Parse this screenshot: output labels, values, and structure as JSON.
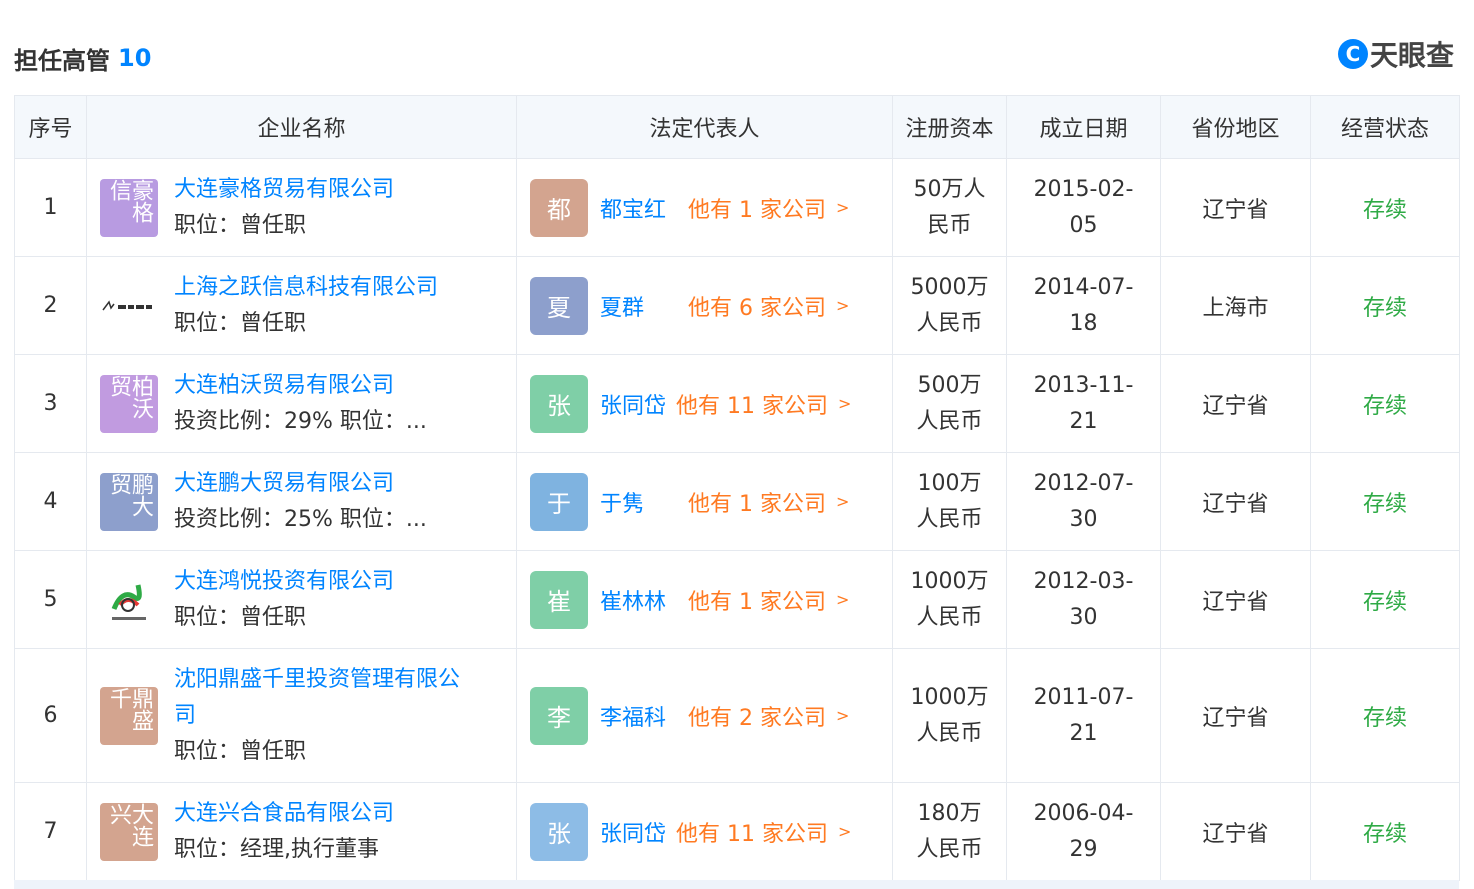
{
  "header": {
    "title": "担任高管",
    "count": "10",
    "brand": "天眼查",
    "brand_mark": "C"
  },
  "table": {
    "columns": [
      "序号",
      "企业名称",
      "法定代表人",
      "注册资本",
      "成立日期",
      "省份地区",
      "经营状态"
    ],
    "rows": [
      {
        "no": "1",
        "logo_text": "豪格信",
        "logo_color": "#b89be1",
        "name": "大连豪格贸易有限公司",
        "sub": "职位：曾任职",
        "rep_initial": "都",
        "rep_color": "#d3a48f",
        "rep_name": "都宝红",
        "rep_link": "他有 1 家公司",
        "capital_1": "50万人",
        "capital_2": "民币",
        "date_1": "2015-02-",
        "date_2": "05",
        "region": "辽宁省",
        "status": "存续"
      },
      {
        "no": "2",
        "logo_text": "",
        "logo_color": "",
        "name": "上海之跃信息科技有限公司",
        "sub": "职位：曾任职",
        "rep_initial": "夏",
        "rep_color": "#8d9fcc",
        "rep_name": "夏群",
        "rep_link": "他有 6 家公司",
        "capital_1": "5000万",
        "capital_2": "人民币",
        "date_1": "2014-07-",
        "date_2": "18",
        "region": "上海市",
        "status": "存续"
      },
      {
        "no": "3",
        "logo_text": "柏沃贸",
        "logo_color": "#c19be0",
        "name": "大连柏沃贸易有限公司",
        "sub": "投资比例：29%   职位：...",
        "rep_initial": "张",
        "rep_color": "#7fcfa7",
        "rep_name": "张同岱",
        "rep_link": "他有 11 家公司",
        "capital_1": "500万",
        "capital_2": "人民币",
        "date_1": "2013-11-",
        "date_2": "21",
        "region": "辽宁省",
        "status": "存续"
      },
      {
        "no": "4",
        "logo_text": "鹏大贸",
        "logo_color": "#8d9fcc",
        "name": "大连鹏大贸易有限公司",
        "sub": "投资比例：25%   职位：...",
        "rep_initial": "于",
        "rep_color": "#7fb3e0",
        "rep_name": "于隽",
        "rep_link": "他有 1 家公司",
        "capital_1": "100万",
        "capital_2": "人民币",
        "date_1": "2012-07-",
        "date_2": "30",
        "region": "辽宁省",
        "status": "存续"
      },
      {
        "no": "5",
        "logo_text": "",
        "logo_color": "",
        "name": "大连鸿悦投资有限公司",
        "sub": "职位：曾任职",
        "rep_initial": "崔",
        "rep_color": "#7fcfa7",
        "rep_name": "崔林林",
        "rep_link": "他有 1 家公司",
        "capital_1": "1000万",
        "capital_2": "人民币",
        "date_1": "2012-03-",
        "date_2": "30",
        "region": "辽宁省",
        "status": "存续"
      },
      {
        "no": "6",
        "logo_text": "鼎盛千",
        "logo_color": "#d3a48f",
        "name_1": "沈阳鼎盛千里投资管理有限公",
        "name_2": "司",
        "sub": "职位：曾任职",
        "rep_initial": "李",
        "rep_color": "#7fcfa7",
        "rep_name": "李福科",
        "rep_link": "他有 2 家公司",
        "capital_1": "1000万",
        "capital_2": "人民币",
        "date_1": "2011-07-",
        "date_2": "21",
        "region": "辽宁省",
        "status": "存续"
      },
      {
        "no": "7",
        "logo_text": "大连兴",
        "logo_color": "#d3a48f",
        "name": "大连兴合食品有限公司",
        "sub": "职位：经理,执行董事",
        "rep_initial": "张",
        "rep_color": "#8dbce6",
        "rep_name": "张同岱",
        "rep_link": "他有 11 家公司",
        "capital_1": "180万",
        "capital_2": "人民币",
        "date_1": "2006-04-",
        "date_2": "29",
        "region": "辽宁省",
        "status": "存续"
      }
    ],
    "chevron": ">"
  }
}
